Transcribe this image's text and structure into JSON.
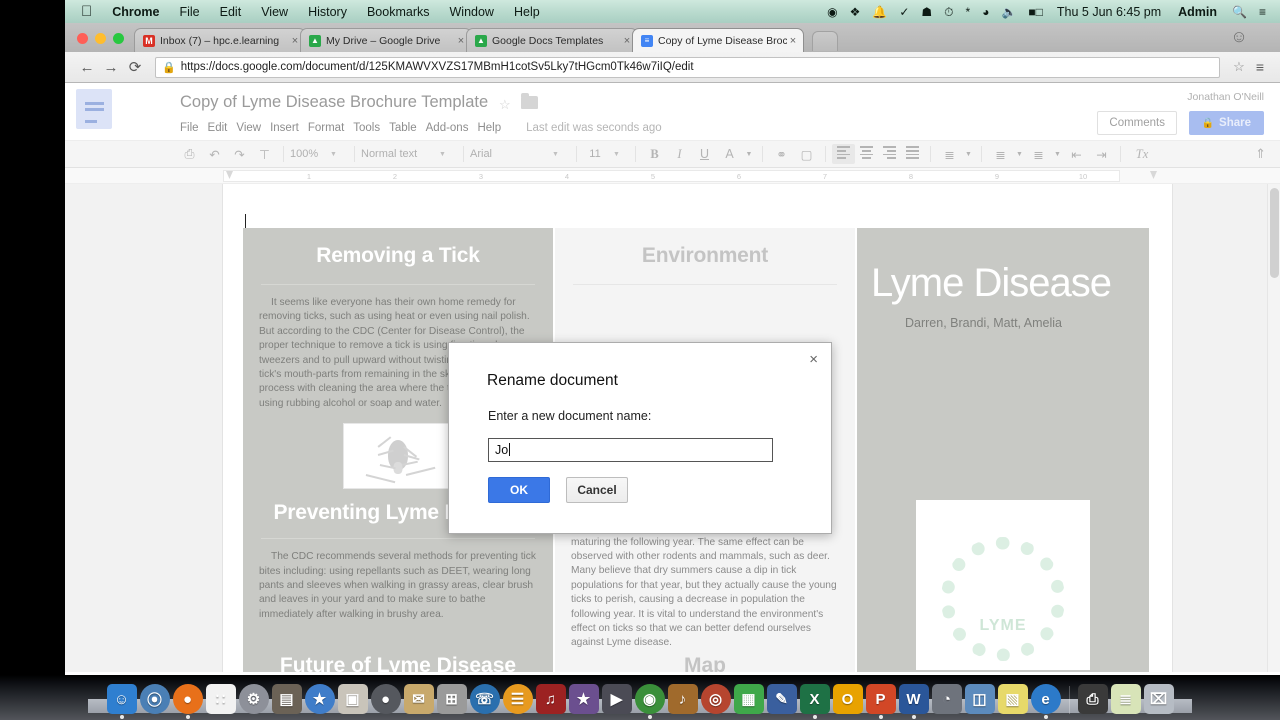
{
  "menubar": {
    "apple": "apple-logo",
    "items": [
      "Chrome",
      "File",
      "Edit",
      "View",
      "History",
      "Bookmarks",
      "Window",
      "Help"
    ],
    "status_icons": [
      "record-icon",
      "dropbox-icon",
      "bell-icon",
      "checkmark-icon",
      "evernote-icon",
      "timemachine-icon",
      "bluetooth-icon",
      "wifi-icon",
      "volume-icon",
      "battery-icon"
    ],
    "clock": "Thu 5 Jun  6:45 pm",
    "user": "Admin",
    "search_icon": "search-icon",
    "notification_icon": "notification-center-icon"
  },
  "browser": {
    "tabs": [
      {
        "title": "Inbox (7) – hpc.e.learning",
        "favicon": "M",
        "favicon_color": "#d93025",
        "active": false
      },
      {
        "title": "My Drive – Google Drive",
        "favicon": "▲",
        "favicon_color": "#1a73e8",
        "active": false
      },
      {
        "title": "Google Docs Templates",
        "favicon": "▲",
        "favicon_color": "#1a73e8",
        "active": false
      },
      {
        "title": "Copy of Lyme Disease Broc",
        "favicon": "≡",
        "favicon_color": "#4285f4",
        "active": true
      }
    ],
    "close_label": "×",
    "url": "https://docs.google.com/document/d/125KMAWVXVZS17MBmH1cotSv5Lky7tHGcm0Tk46w7iIQ/edit",
    "back_icon": "←",
    "forward_icon": "→",
    "reload_icon": "⟳",
    "lock_icon": "🔒",
    "bookmark_icon": "☆",
    "menu_icon": "≡"
  },
  "docs": {
    "title": "Copy of Lyme Disease Brochure Template",
    "menu": [
      "File",
      "Edit",
      "View",
      "Insert",
      "Format",
      "Tools",
      "Table",
      "Add-ons",
      "Help"
    ],
    "last_edit": "Last edit was seconds ago",
    "user": "Jonathan O'Neill",
    "user_caret": "▾",
    "comments_label": "Comments",
    "share_label": "Share",
    "share_lock_icon": "🔒",
    "toolbar": {
      "print_icon": "⎙",
      "undo_icon": "↶",
      "redo_icon": "↷",
      "paint_icon": "⎙",
      "zoom": "100%",
      "style": "Normal text",
      "font": "Arial",
      "size": "11",
      "bold": "B",
      "italic": "I",
      "underline": "U",
      "text_color": "A",
      "link_icon": "∞",
      "image_icon": "▣",
      "numbered_list_icon": "≣",
      "bulleted_list_icon": "≡",
      "indent_less_icon": "⇤",
      "indent_more_icon": "⇥",
      "clear_format_icon": "Tx",
      "collapse_icon": "«",
      "caret": "▾"
    },
    "ruler_numbers": [
      "1",
      "2",
      "3",
      "4",
      "5",
      "6",
      "7",
      "8",
      "9",
      "10"
    ]
  },
  "brochure": {
    "left_column": {
      "heading1": "Removing a Tick",
      "paragraph1": "It seems like everyone has their own home remedy for removing ticks, such as using heat or even using nail polish. But according to the CDC (Center for Disease Control), the proper technique to remove a tick is using fine tipped tweezers and to pull upward without twisting to prevent the tick's mouth-parts from remaining in the skin. Then finish the process with cleaning the area where the tick was attached using rubbing alcohol or soap and water.",
      "image": "tick-illustration",
      "heading2": "Preventing Lyme Disease",
      "paragraph2": "The CDC recommends several methods for preventing tick bites including: using repellants such as DEET, wearing long pants and sleeves when walking in grassy areas, clear brush and leaves in your yard and to make sure to bathe immediately after walking in brushy area.",
      "heading3": "Future of Lyme Disease"
    },
    "middle_column": {
      "heading1": "Environment",
      "paragraph1": "populations. This explains why tick populations tend to be down a year and a half after a severe winter. Cold winters knock mouse populations; this in turn reduces the probability of a tick larvae finding a host in the spring and maturing the following year. The same effect can be observed with other rodents and mammals, such as deer. Many believe that dry summers cause a dip in tick populations for that year, but they actually cause the young ticks to perish, causing a decrease in population the following year. It is vital to understand the environment's effect on ticks so that we can better defend ourselves against Lyme disease.",
      "heading2": "Map"
    },
    "right_column": {
      "title": "Lyme Disease",
      "byline": "Darren, Brandi, Matt, Amelia",
      "logo_text": "LYME",
      "logo": "wreath-logo"
    }
  },
  "dialog": {
    "title": "Rename document",
    "label": "Enter a new document name:",
    "input_value": "Jo",
    "ok_label": "OK",
    "cancel_label": "Cancel",
    "close_icon": "×"
  },
  "dock": {
    "items": [
      {
        "name": "finder",
        "glyph": "☺",
        "color": "#2f7fd0"
      },
      {
        "name": "safari",
        "glyph": "⦿",
        "color": "#4a7fb5"
      },
      {
        "name": "firefox",
        "glyph": "●",
        "color": "#e8701a"
      },
      {
        "name": "launchpad",
        "glyph": "∷",
        "color": "#f2f2f2"
      },
      {
        "name": "disk-utility",
        "glyph": "⚙",
        "color": "#8d9099"
      },
      {
        "name": "archive-utility",
        "glyph": "▤",
        "color": "#6b6256"
      },
      {
        "name": "app-store",
        "glyph": "★",
        "color": "#3f7dc9"
      },
      {
        "name": "preview",
        "glyph": "▣",
        "color": "#c9c4ba"
      },
      {
        "name": "system-preferences",
        "glyph": "●",
        "color": "#55585e"
      },
      {
        "name": "contacts",
        "glyph": "✉",
        "color": "#c8a96c"
      },
      {
        "name": "calculator",
        "glyph": "⊞",
        "color": "#9a9a9a"
      },
      {
        "name": "facetime",
        "glyph": "☏",
        "color": "#2a6fae"
      },
      {
        "name": "ibooks",
        "glyph": "☰",
        "color": "#e79a1f"
      },
      {
        "name": "itunes",
        "glyph": "♫",
        "color": "#9c2222"
      },
      {
        "name": "imovie",
        "glyph": "★",
        "color": "#6b4f8f"
      },
      {
        "name": "final-cut",
        "glyph": "▶",
        "color": "#4b4b55"
      },
      {
        "name": "chrome",
        "glyph": "◉",
        "color": "#3a8f3a"
      },
      {
        "name": "garageband",
        "glyph": "♪",
        "color": "#a06a2c"
      },
      {
        "name": "photo-booth",
        "glyph": "◎",
        "color": "#b6452f"
      },
      {
        "name": "numbers",
        "glyph": "▦",
        "color": "#3fa84a"
      },
      {
        "name": "pages",
        "glyph": "✎",
        "color": "#3a5f9e"
      },
      {
        "name": "microsoft-excel",
        "glyph": "X",
        "color": "#1e7145"
      },
      {
        "name": "microsoft-outlook",
        "glyph": "O",
        "color": "#e8a200"
      },
      {
        "name": "microsoft-powerpoint",
        "glyph": "P",
        "color": "#d24726"
      },
      {
        "name": "microsoft-word",
        "glyph": "W",
        "color": "#2a5699"
      },
      {
        "name": "activity-monitor",
        "glyph": "◔",
        "color": "#6e737c"
      },
      {
        "name": "image-capture",
        "glyph": "◫",
        "color": "#5c8bbd"
      },
      {
        "name": "stickies",
        "glyph": "▧",
        "color": "#e7d96a"
      },
      {
        "name": "internet-explorer",
        "glyph": "e",
        "color": "#2c7ac9"
      },
      {
        "name": "printer",
        "glyph": "⎙",
        "color": "#3a3a3a"
      },
      {
        "name": "downloads-stack",
        "glyph": "≣",
        "color": "#d8e4b8"
      },
      {
        "name": "trash",
        "glyph": "⌧",
        "color": "#b6bcc4"
      }
    ]
  }
}
